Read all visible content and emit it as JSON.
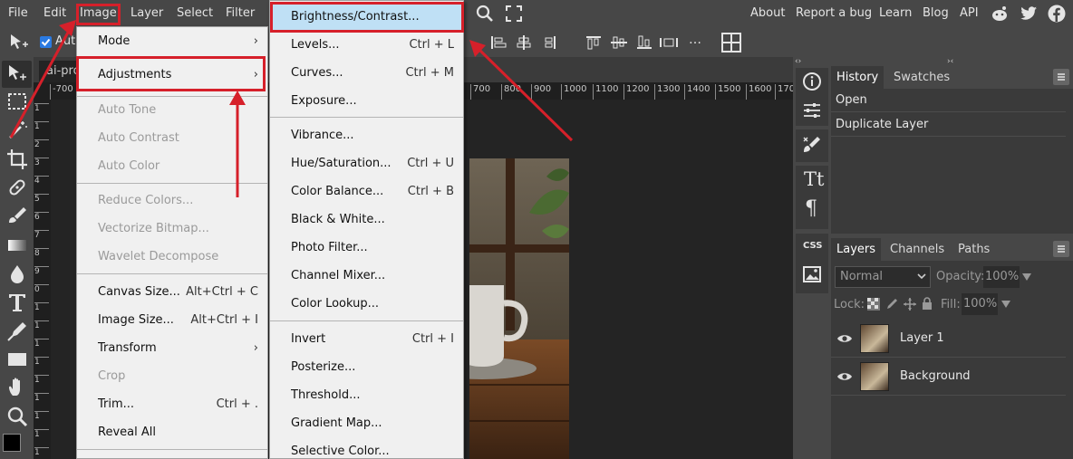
{
  "menubar": {
    "items": [
      "File",
      "Edit",
      "Image",
      "Layer",
      "Select",
      "Filter"
    ],
    "links": [
      "About",
      "Report a bug",
      "Learn",
      "Blog",
      "API"
    ]
  },
  "options": {
    "auto_label": "Auto"
  },
  "document": {
    "tab_label": "ai-pro",
    "ruler_h": [
      "-700",
      "700",
      "800",
      "900",
      "1000",
      "1100",
      "1200",
      "1300",
      "1400",
      "1500",
      "1600",
      "170"
    ],
    "ruler_v": [
      "1",
      "1",
      "2",
      "3",
      "4",
      "5",
      "6",
      "7",
      "8",
      "9",
      "0",
      "1",
      "1",
      "1",
      "1",
      "1",
      "1",
      "1",
      "1",
      "1"
    ]
  },
  "image_menu": {
    "items": [
      {
        "label": "Mode",
        "shortcut": "",
        "submenu": true,
        "disabled": false
      },
      {
        "label": "Adjustments",
        "shortcut": "",
        "submenu": true,
        "disabled": false
      },
      {
        "label": "Auto Tone",
        "shortcut": "",
        "submenu": false,
        "disabled": true
      },
      {
        "label": "Auto Contrast",
        "shortcut": "",
        "submenu": false,
        "disabled": true
      },
      {
        "label": "Auto Color",
        "shortcut": "",
        "submenu": false,
        "disabled": true
      },
      {
        "label": "Reduce Colors...",
        "shortcut": "",
        "submenu": false,
        "disabled": true
      },
      {
        "label": "Vectorize Bitmap...",
        "shortcut": "",
        "submenu": false,
        "disabled": true
      },
      {
        "label": "Wavelet Decompose",
        "shortcut": "",
        "submenu": false,
        "disabled": true
      },
      {
        "label": "Canvas Size...",
        "shortcut": "Alt+Ctrl + C",
        "submenu": false,
        "disabled": false
      },
      {
        "label": "Image Size...",
        "shortcut": "Alt+Ctrl + I",
        "submenu": false,
        "disabled": false
      },
      {
        "label": "Transform",
        "shortcut": "",
        "submenu": true,
        "disabled": false
      },
      {
        "label": "Crop",
        "shortcut": "",
        "submenu": false,
        "disabled": true
      },
      {
        "label": "Trim...",
        "shortcut": "Ctrl + .",
        "submenu": false,
        "disabled": false
      },
      {
        "label": "Reveal All",
        "shortcut": "",
        "submenu": false,
        "disabled": false
      }
    ]
  },
  "adjust_menu": {
    "items": [
      {
        "label": "Brightness/Contrast...",
        "shortcut": ""
      },
      {
        "label": "Levels...",
        "shortcut": "Ctrl + L"
      },
      {
        "label": "Curves...",
        "shortcut": "Ctrl + M"
      },
      {
        "label": "Exposure...",
        "shortcut": ""
      },
      {
        "label": "Vibrance...",
        "shortcut": ""
      },
      {
        "label": "Hue/Saturation...",
        "shortcut": "Ctrl + U"
      },
      {
        "label": "Color Balance...",
        "shortcut": "Ctrl + B"
      },
      {
        "label": "Black & White...",
        "shortcut": ""
      },
      {
        "label": "Photo Filter...",
        "shortcut": ""
      },
      {
        "label": "Channel Mixer...",
        "shortcut": ""
      },
      {
        "label": "Color Lookup...",
        "shortcut": ""
      },
      {
        "label": "Invert",
        "shortcut": "Ctrl + I"
      },
      {
        "label": "Posterize...",
        "shortcut": ""
      },
      {
        "label": "Threshold...",
        "shortcut": ""
      },
      {
        "label": "Gradient Map...",
        "shortcut": ""
      },
      {
        "label": "Selective Color...",
        "shortcut": ""
      }
    ]
  },
  "history_panel": {
    "tabs": [
      "History",
      "Swatches"
    ],
    "items": [
      "Open",
      "Duplicate Layer"
    ]
  },
  "layers_panel": {
    "tabs": [
      "Layers",
      "Channels",
      "Paths"
    ],
    "blend_mode": "Normal",
    "opacity_label": "Opacity:",
    "opacity_value": "100%",
    "lock_label": "Lock:",
    "fill_label": "Fill:",
    "fill_value": "100%",
    "layers": [
      "Layer 1",
      "Background"
    ]
  },
  "side_icons": {
    "css_label": "CSS",
    "text_label": "Tt",
    "para_label": "¶"
  },
  "colors": {
    "highlight_red": "#d6202a",
    "menu_hover": "#bfe0f5",
    "panel_bg": "#3a3a3a",
    "app_bg": "#474747"
  }
}
